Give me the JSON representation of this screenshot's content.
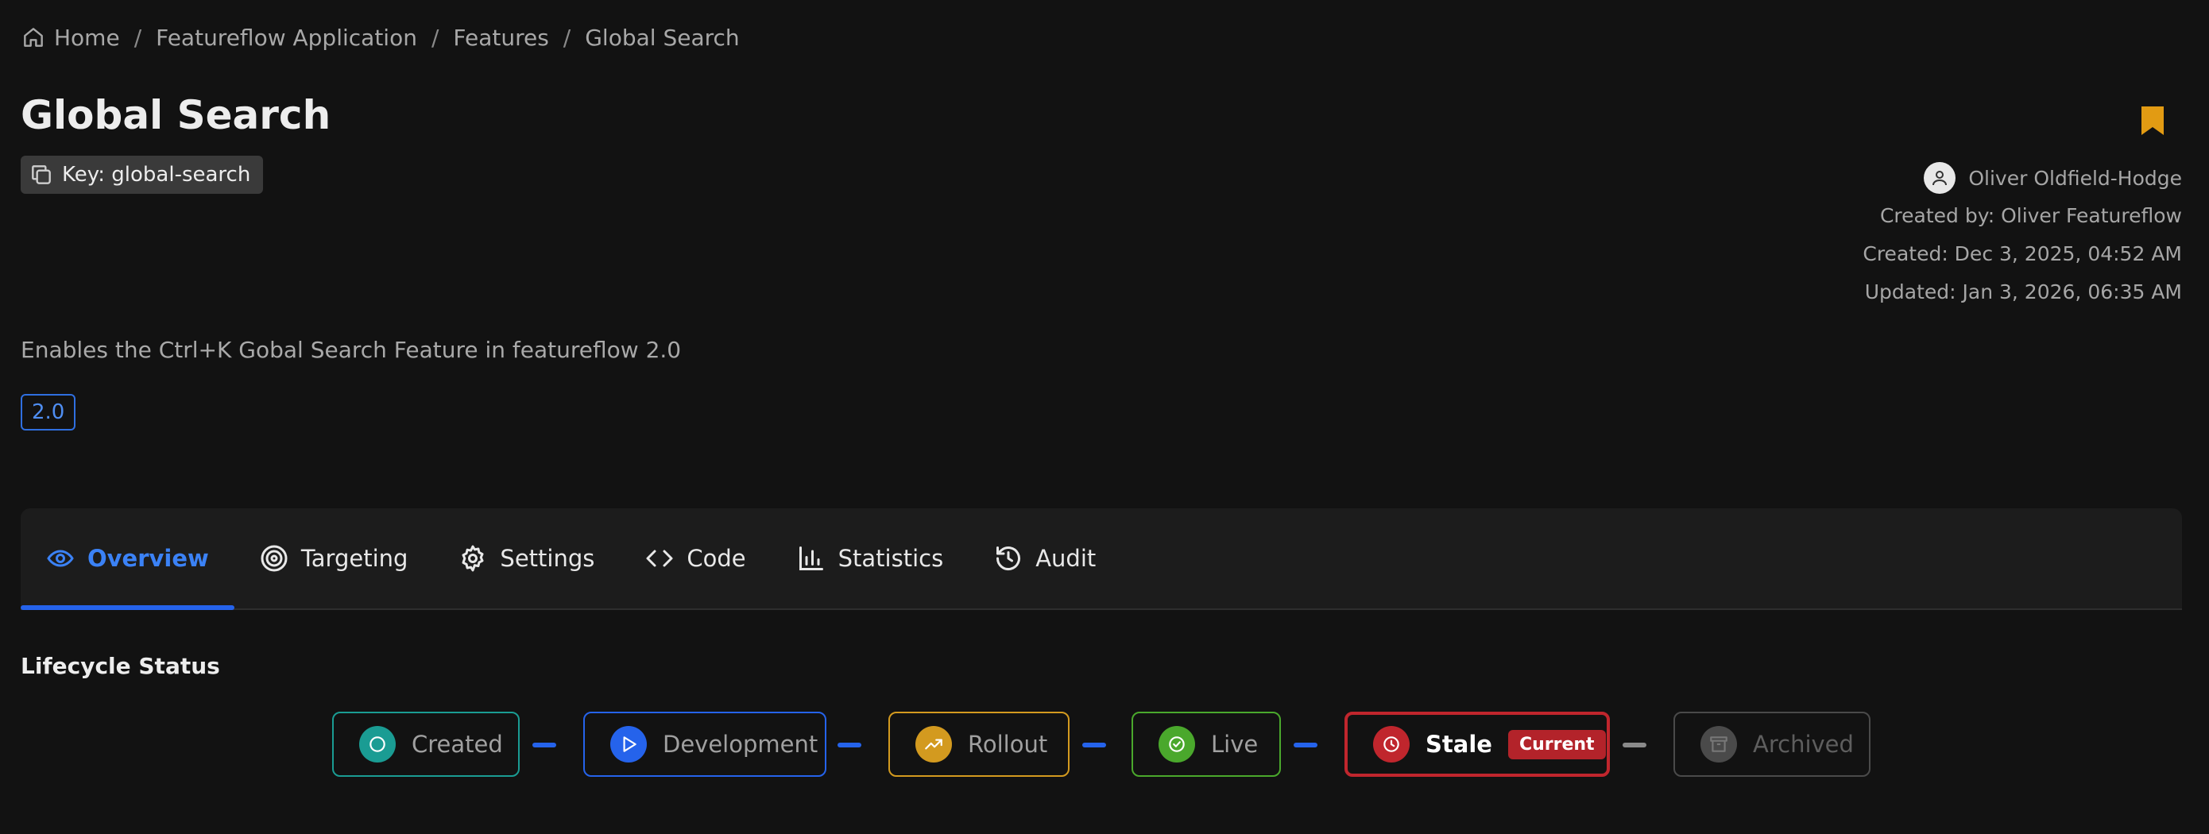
{
  "breadcrumb": {
    "items": [
      "Home",
      "Featureflow Application",
      "Features",
      "Global Search"
    ],
    "separator": "/"
  },
  "feature": {
    "title": "Global Search",
    "key_label": "Key: global-search",
    "description": "Enables the Ctrl+K Gobal Search Feature in featureflow 2.0",
    "tag": "2.0"
  },
  "meta": {
    "owner": "Oliver Oldfield-Hodge",
    "created_by": "Created by: Oliver Featureflow",
    "created": "Created: Dec 3, 2025, 04:52 AM",
    "updated": "Updated: Jan 3, 2026, 06:35 AM"
  },
  "tabs": [
    {
      "label": "Overview",
      "icon": "eye-icon",
      "active": true
    },
    {
      "label": "Targeting",
      "icon": "target-icon",
      "active": false
    },
    {
      "label": "Settings",
      "icon": "gear-icon",
      "active": false
    },
    {
      "label": "Code",
      "icon": "code-icon",
      "active": false
    },
    {
      "label": "Statistics",
      "icon": "bar-chart-icon",
      "active": false
    },
    {
      "label": "Audit",
      "icon": "history-icon",
      "active": false
    }
  ],
  "lifecycle": {
    "title": "Lifecycle Status",
    "current_badge": "Current",
    "stages": [
      {
        "label": "Created",
        "icon": "circle-icon",
        "color": "#1a9c93"
      },
      {
        "label": "Development",
        "icon": "play-icon",
        "color": "#2563eb"
      },
      {
        "label": "Rollout",
        "icon": "trending-up-icon",
        "color": "#d39a1f"
      },
      {
        "label": "Live",
        "icon": "check-circle-icon",
        "color": "#4aa82c"
      },
      {
        "label": "Stale",
        "icon": "clock-icon",
        "color": "#c0262d",
        "current": true
      },
      {
        "label": "Archived",
        "icon": "archive-icon",
        "color": "#555555"
      }
    ]
  },
  "colors": {
    "accent": "#2563eb",
    "bookmark": "#e29b13",
    "background": "#121212"
  }
}
